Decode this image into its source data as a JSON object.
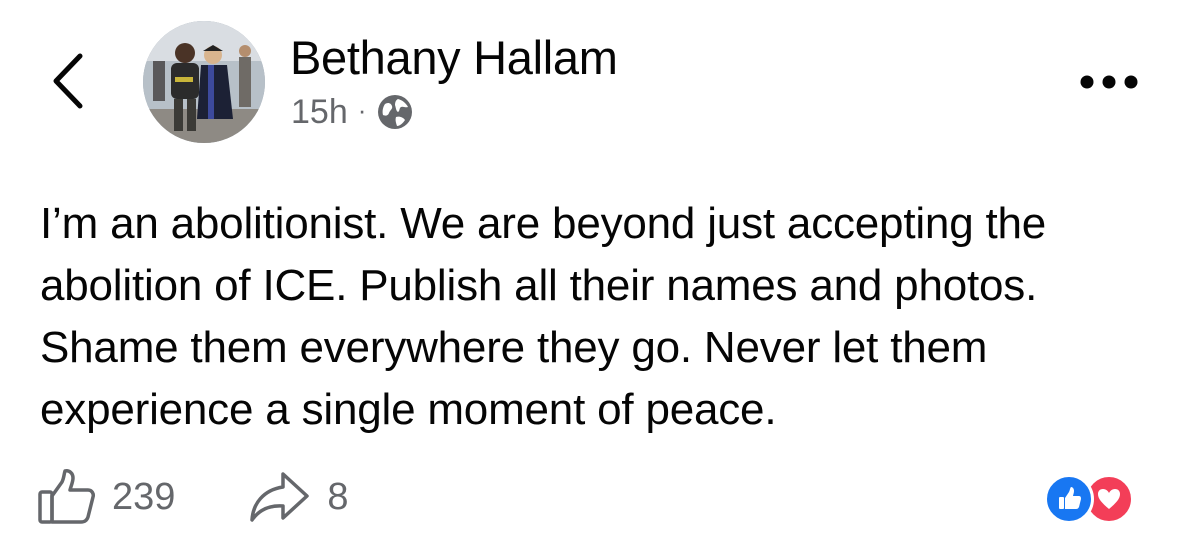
{
  "header": {
    "author_name": "Bethany Hallam",
    "timestamp": "15h",
    "separator": "·",
    "privacy_icon": "globe-icon",
    "back_icon": "chevron-left-icon",
    "more_icon": "more-horizontal-icon"
  },
  "post": {
    "text": "I’m an abolitionist. We are beyond just accepting the abolition of ICE. Publish all their names and photos. Shame them everywhere they go. Never let them experience a single moment of peace."
  },
  "footer": {
    "like_icon": "thumbs-up-icon",
    "like_count": "239",
    "share_icon": "share-arrow-icon",
    "share_count": "8",
    "reactions": [
      "like",
      "love"
    ]
  },
  "colors": {
    "text": "#050505",
    "secondary_text": "#65676b",
    "like_blue": "#1877f2",
    "love_red": "#f33e58",
    "background": "#ffffff"
  }
}
